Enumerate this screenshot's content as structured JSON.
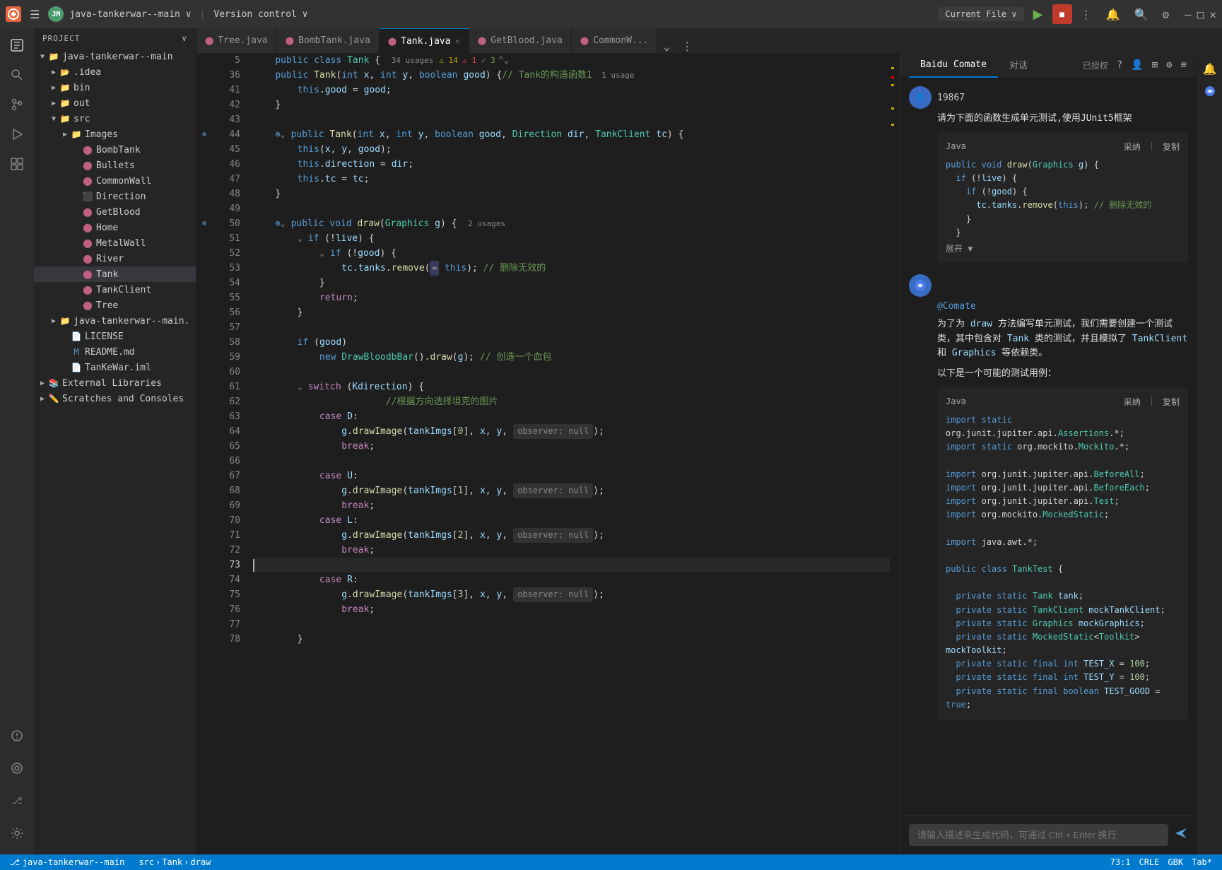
{
  "titlebar": {
    "icon_label": "JB",
    "menu_icon": "☰",
    "avatar_label": "JM",
    "project_name": "java-tankerwar--main",
    "project_arrow": "∨",
    "vcs_label": "Version control",
    "vcs_arrow": "∨",
    "current_file_label": "Current File",
    "current_file_arrow": "∨",
    "run_symbol": "▶",
    "stop_symbol": "■",
    "more_icon": "⋮",
    "search_icon": "🔍",
    "settings_icon": "⚙",
    "minimize": "—",
    "maximize": "□",
    "close": "✕"
  },
  "activity_bar": {
    "items": [
      {
        "name": "explorer-icon",
        "symbol": "📁",
        "active": true
      },
      {
        "name": "search-icon",
        "symbol": "🔍",
        "active": false
      },
      {
        "name": "vcs-icon",
        "symbol": "⎇",
        "active": false
      },
      {
        "name": "run-icon",
        "symbol": "▷",
        "active": false
      },
      {
        "name": "extensions-icon",
        "symbol": "⊞",
        "active": false
      }
    ],
    "bottom_items": [
      {
        "name": "problems-icon",
        "symbol": "⚠"
      },
      {
        "name": "debug-icon",
        "symbol": "🐛"
      },
      {
        "name": "git-icon",
        "symbol": "⎇"
      },
      {
        "name": "settings-icon",
        "symbol": "⚙"
      }
    ]
  },
  "sidebar": {
    "title": "Project",
    "title_arrow": "∨",
    "tree": [
      {
        "indent": 0,
        "arrow": "▼",
        "icon": "folder",
        "label": "java-tankerwar--main",
        "level": 0
      },
      {
        "indent": 1,
        "arrow": "▶",
        "icon": "dot-folder",
        "label": ".idea",
        "level": 1
      },
      {
        "indent": 1,
        "arrow": "▶",
        "icon": "folder",
        "label": "bin",
        "level": 1
      },
      {
        "indent": 1,
        "arrow": "▶",
        "icon": "folder",
        "label": "out",
        "level": 1
      },
      {
        "indent": 1,
        "arrow": "▼",
        "icon": "folder",
        "label": "src",
        "level": 1
      },
      {
        "indent": 2,
        "arrow": "▶",
        "icon": "folder",
        "label": "Images",
        "level": 2
      },
      {
        "indent": 2,
        "arrow": "",
        "icon": "java",
        "label": "BombTank",
        "level": 2
      },
      {
        "indent": 2,
        "arrow": "",
        "icon": "java",
        "label": "Bullets",
        "level": 2
      },
      {
        "indent": 2,
        "arrow": "",
        "icon": "java",
        "label": "CommonWall",
        "level": 2
      },
      {
        "indent": 2,
        "arrow": "",
        "icon": "java",
        "label": "Direction",
        "level": 2
      },
      {
        "indent": 2,
        "arrow": "",
        "icon": "java",
        "label": "GetBlood",
        "level": 2
      },
      {
        "indent": 2,
        "arrow": "",
        "icon": "java",
        "label": "Home",
        "level": 2
      },
      {
        "indent": 2,
        "arrow": "",
        "icon": "java",
        "label": "MetalWall",
        "level": 2
      },
      {
        "indent": 2,
        "arrow": "",
        "icon": "java",
        "label": "River",
        "level": 2
      },
      {
        "indent": 2,
        "arrow": "",
        "icon": "java",
        "label": "Tank",
        "level": 2,
        "selected": true
      },
      {
        "indent": 2,
        "arrow": "",
        "icon": "java",
        "label": "TankClient",
        "level": 2
      },
      {
        "indent": 2,
        "arrow": "",
        "icon": "java",
        "label": "Tree",
        "level": 2
      },
      {
        "indent": 1,
        "arrow": "▶",
        "icon": "folder",
        "label": "java-tankerwar--main.",
        "level": 1
      },
      {
        "indent": 1,
        "arrow": "",
        "icon": "file",
        "label": "LICENSE",
        "level": 1
      },
      {
        "indent": 1,
        "arrow": "",
        "icon": "md",
        "label": "README.md",
        "level": 1
      },
      {
        "indent": 1,
        "arrow": "",
        "icon": "iml",
        "label": "TanKeWar.iml",
        "level": 1
      },
      {
        "indent": 0,
        "arrow": "▶",
        "icon": "ext-lib",
        "label": "External Libraries",
        "level": 0
      },
      {
        "indent": 0,
        "arrow": "▶",
        "icon": "scratch",
        "label": "Scratches and Consoles",
        "level": 0
      }
    ]
  },
  "tabs": [
    {
      "label": "Tree.java",
      "icon": "java",
      "active": false,
      "modified": false
    },
    {
      "label": "BombTank.java",
      "icon": "java",
      "active": false,
      "modified": false
    },
    {
      "label": "Tank.java",
      "icon": "java",
      "active": true,
      "modified": false
    },
    {
      "label": "GetBlood.java",
      "icon": "java",
      "active": false,
      "modified": false
    },
    {
      "label": "CommonW...",
      "icon": "java",
      "active": false,
      "modified": false
    }
  ],
  "code": {
    "lines": [
      {
        "num": 5,
        "content": "    public class Tank {  34 usages",
        "warnings": "⚠ 14  ⚠ 1  ✓ 3"
      },
      {
        "num": 36,
        "content": "    public Tank(int x, int y, boolean good) {// Tank的构造函数1  1 usage"
      },
      {
        "num": 41,
        "content": "        this.good = good;"
      },
      {
        "num": 42,
        "content": "    }"
      },
      {
        "num": 43,
        "content": ""
      },
      {
        "num": 44,
        "content": "    public Tank(int x, int y, boolean good, Direction dir, TankClient tc) {"
      },
      {
        "num": 45,
        "content": "        this(x, y, good);"
      },
      {
        "num": 46,
        "content": "        this.direction = dir;"
      },
      {
        "num": 47,
        "content": "        this.tc = tc;"
      },
      {
        "num": 48,
        "content": "    }"
      },
      {
        "num": 49,
        "content": ""
      },
      {
        "num": 50,
        "content": "    public void draw(Graphics g) {  2 usages"
      },
      {
        "num": 51,
        "content": "        if (!live) {"
      },
      {
        "num": 52,
        "content": "            if (!good) {"
      },
      {
        "num": 53,
        "content": "                tc.tanks.remove(  this); // 删除无效的"
      },
      {
        "num": 54,
        "content": "            }"
      },
      {
        "num": 55,
        "content": "            return;"
      },
      {
        "num": 56,
        "content": "        }"
      },
      {
        "num": 57,
        "content": ""
      },
      {
        "num": 58,
        "content": "        if (good)"
      },
      {
        "num": 59,
        "content": "            new DrawBloodbBar().draw(g); // 创造一个血包"
      },
      {
        "num": 60,
        "content": ""
      },
      {
        "num": 61,
        "content": "        switch (Kdirection) {"
      },
      {
        "num": 62,
        "content": "                        //根据方向选择坦克的图片"
      },
      {
        "num": 63,
        "content": "            case D:"
      },
      {
        "num": 64,
        "content": "                g.drawImage(tankImgs[0], x, y,   observer: null);"
      },
      {
        "num": 65,
        "content": "                break;"
      },
      {
        "num": 66,
        "content": ""
      },
      {
        "num": 67,
        "content": "            case U:"
      },
      {
        "num": 68,
        "content": "                g.drawImage(tankImgs[1], x, y,   observer: null);"
      },
      {
        "num": 69,
        "content": "                break;"
      },
      {
        "num": 70,
        "content": "            case L:"
      },
      {
        "num": 71,
        "content": "                g.drawImage(tankImgs[2], x, y,   observer: null);"
      },
      {
        "num": 72,
        "content": "                break;"
      },
      {
        "num": 73,
        "content": "",
        "current": true
      },
      {
        "num": 74,
        "content": "            case R:"
      },
      {
        "num": 75,
        "content": "                g.drawImage(tankImgs[3], x, y,   observer: null);"
      },
      {
        "num": 76,
        "content": "                break;"
      },
      {
        "num": 77,
        "content": ""
      },
      {
        "num": 78,
        "content": "        }"
      }
    ]
  },
  "right_panel": {
    "tabs": [
      {
        "label": "Baidu Comate",
        "active": true
      },
      {
        "label": "对话",
        "active": false
      }
    ],
    "authorized_label": "已授权",
    "user_id": "19867",
    "system_msg": "请为下面的函数生成单元测试,使用JUnit5框架",
    "code_preview": {
      "lang": "Java",
      "adopt_label": "采纳",
      "copy_label": "复制",
      "lines": [
        "public void draw(Graphics g) {",
        "    if (!live) {",
        "        if (!good) {",
        "            tc.tanks.remove(this); // 删除无效的",
        "        }",
        "    }"
      ],
      "expand_label": "展开 ▼"
    },
    "at_mention": "@Comate",
    "response_msg1": "为了为 draw 方法编写单元测试，我们需要创建一个测试类，其中包含对 Tank 类的测试，并且模拟了 TankClient 和 Graphics 等依赖类。",
    "response_msg2": "以下是一个可能的测试用例：",
    "code_block": {
      "lang": "Java",
      "adopt_label": "采纳",
      "copy_label": "复制",
      "lines": [
        "import static org.junit.jupiter.api.Assertions.*;",
        "import static org.mockito.Mockito.*;",
        "",
        "import org.junit.jupiter.api.BeforeAll;",
        "import org.junit.jupiter.api.BeforeEach;",
        "import org.junit.jupiter.api.Test;",
        "import org.mockito.MockedStatic;",
        "",
        "import java.awt.*;",
        "",
        "public class TankTest {",
        "",
        "    private static Tank tank;",
        "    private static TankClient mockTankClient;",
        "    private static Graphics mockGraphics;",
        "    private static MockedStatic<Toolkit> mockToolkit;",
        "    private static final int TEST_X = 100;",
        "    private static final int TEST_Y = 100;",
        "    private static final boolean TEST_GOOD = true;"
      ]
    },
    "input_placeholder": "请输入描述来生成代码，可通过 Ctrl + Enter 换行"
  },
  "status_bar": {
    "branch_icon": "⎇",
    "branch_name": "java-tankerwar--main",
    "src_label": "src",
    "tank_label": "Tank",
    "draw_label": "draw",
    "position": "73:1",
    "encoding": "CRLE",
    "charset": "GBK",
    "tab_label": "Tab*"
  }
}
